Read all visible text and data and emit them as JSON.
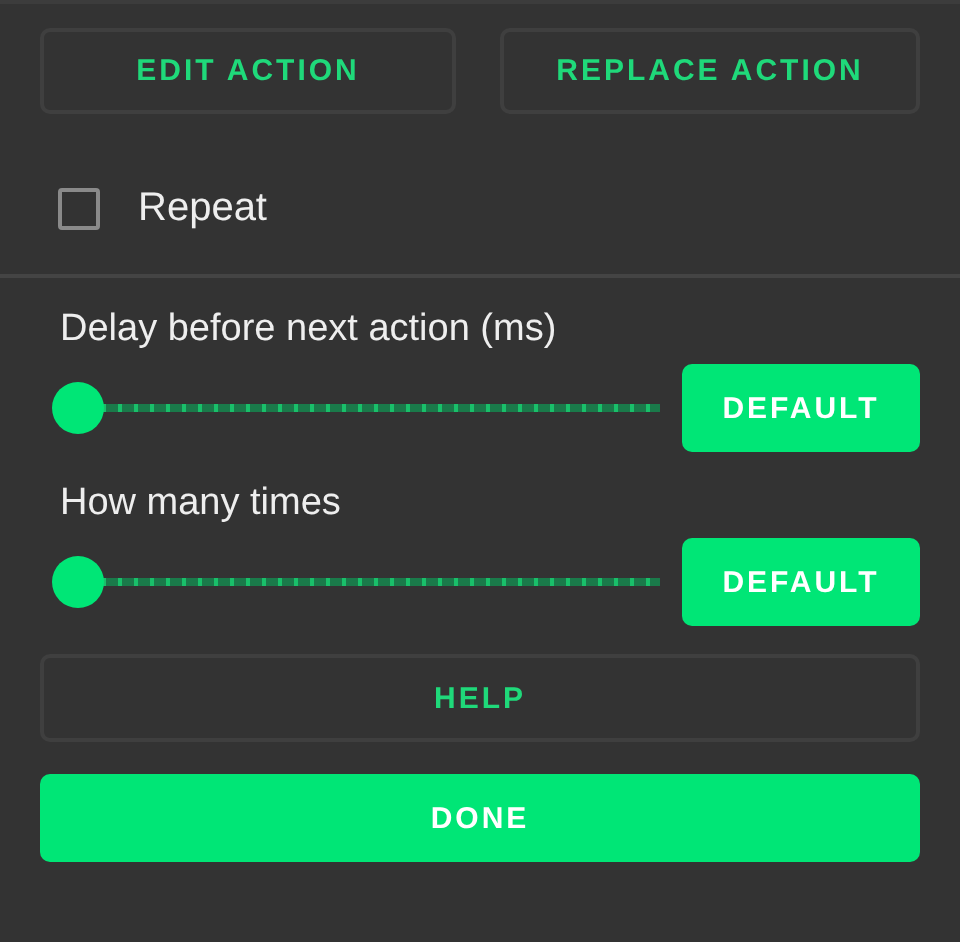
{
  "top_buttons": [
    "EDIT ACTION",
    "REPLACE ACTION"
  ],
  "repeat": {
    "label": "Repeat",
    "checked": false
  },
  "sliders": [
    {
      "label": "Delay before next action (ms)",
      "level": 0,
      "button": "DEFAULT"
    },
    {
      "label": "How many times",
      "level": 0,
      "button": "DEFAULT"
    }
  ],
  "help_button": "HELP",
  "done_button": "DONE"
}
